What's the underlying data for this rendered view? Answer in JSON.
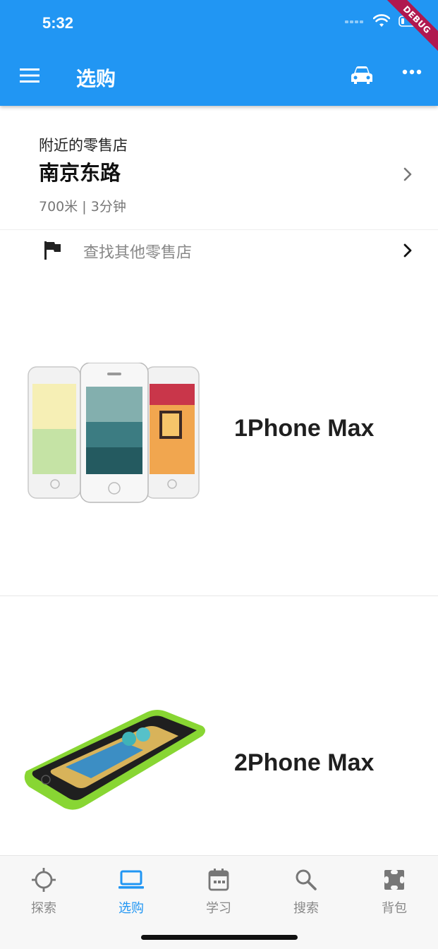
{
  "status": {
    "time": "5:32",
    "debug_label": "DEBUG"
  },
  "appbar": {
    "title": "选购",
    "background": "#2196f3"
  },
  "store": {
    "nearby_label": "附近的零售店",
    "name": "南京东路",
    "distance": "700米 | 3分钟"
  },
  "find_store": {
    "label": "查找其他零售店"
  },
  "products": [
    {
      "name": "1Phone Max"
    },
    {
      "name": "2Phone Max"
    }
  ],
  "bottom_nav": {
    "items": [
      {
        "label": "探索",
        "icon": "crosshair-icon"
      },
      {
        "label": "选购",
        "icon": "laptop-icon"
      },
      {
        "label": "学习",
        "icon": "calendar-icon"
      },
      {
        "label": "搜索",
        "icon": "search-icon"
      },
      {
        "label": "背包",
        "icon": "shopping-bag-icon"
      }
    ],
    "active_index": 1,
    "active_color": "#2196f3"
  }
}
